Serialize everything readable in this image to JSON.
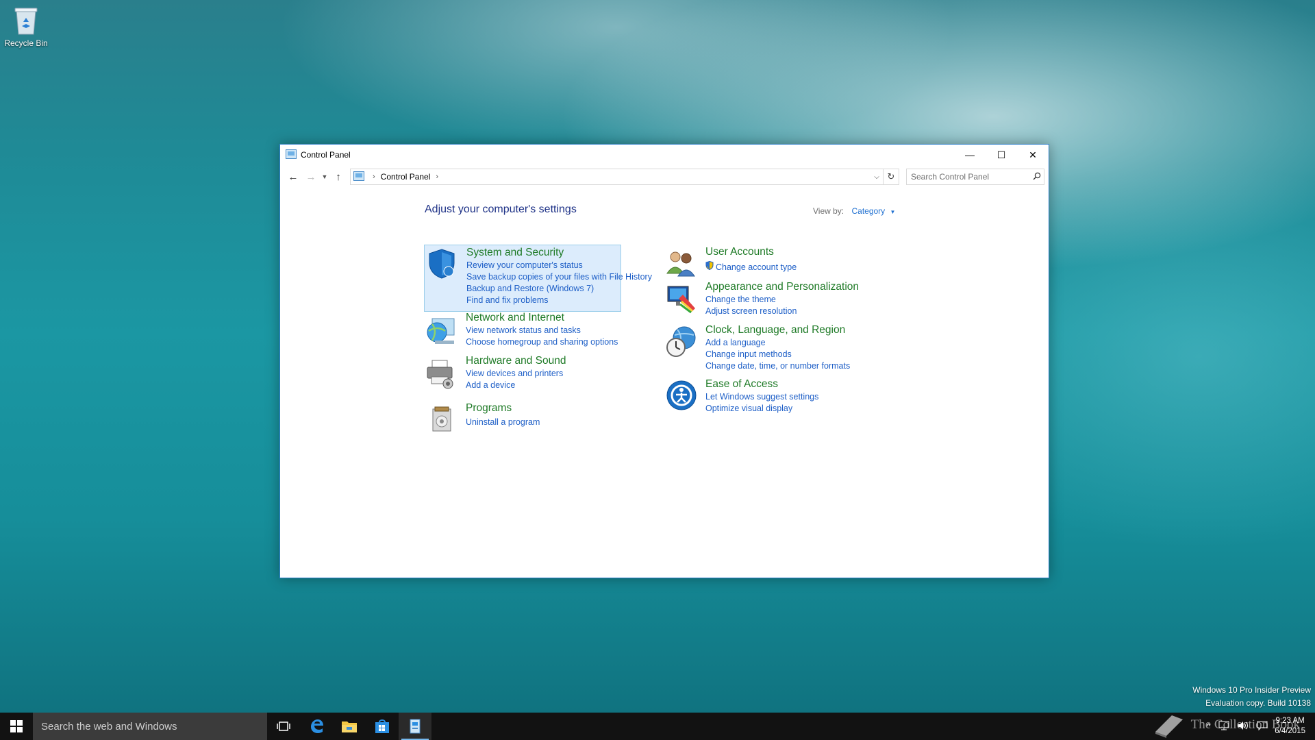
{
  "desktop": {
    "recycle_bin_label": "Recycle Bin"
  },
  "window": {
    "title": "Control Panel",
    "controls": {
      "minimize": "—",
      "maximize": "☐",
      "close": "✕"
    }
  },
  "navigation": {
    "breadcrumb": [
      "Control Panel"
    ],
    "search_placeholder": "Search Control Panel"
  },
  "content": {
    "heading": "Adjust your computer's settings",
    "view_by_label": "View by:",
    "view_by_value": "Category"
  },
  "categories_left": [
    {
      "title": "System and Security",
      "icon": "shield-icon",
      "links": [
        "Review your computer's status",
        "Save backup copies of your files with File History",
        "Backup and Restore (Windows 7)",
        "Find and fix problems"
      ]
    },
    {
      "title": "Network and Internet",
      "icon": "network-globe-icon",
      "links": [
        "View network status and tasks",
        "Choose homegroup and sharing options"
      ]
    },
    {
      "title": "Hardware and Sound",
      "icon": "printer-icon",
      "links": [
        "View devices and printers",
        "Add a device"
      ]
    },
    {
      "title": "Programs",
      "icon": "programs-icon",
      "links": [
        "Uninstall a program"
      ]
    }
  ],
  "categories_right": [
    {
      "title": "User Accounts",
      "icon": "users-icon",
      "links": [
        "Change account type"
      ]
    },
    {
      "title": "Appearance and Personalization",
      "icon": "monitor-paint-icon",
      "links": [
        "Change the theme",
        "Adjust screen resolution"
      ]
    },
    {
      "title": "Clock, Language, and Region",
      "icon": "clock-globe-icon",
      "links": [
        "Add a language",
        "Change input methods",
        "Change date, time, or number formats"
      ]
    },
    {
      "title": "Ease of Access",
      "icon": "ease-of-access-icon",
      "links": [
        "Let Windows suggest settings",
        "Optimize visual display"
      ]
    }
  ],
  "taskbar": {
    "search_placeholder": "Search the web and Windows",
    "clock_time": "9:23 AM",
    "clock_date": "6/4/2015"
  },
  "watermark": {
    "line1": "Windows 10 Pro Insider Preview",
    "line2": "Evaluation copy. Build 10138",
    "overlay_text": "The Collection Book"
  },
  "colors": {
    "category_title": "#1e7a26",
    "link": "#1e5fc7",
    "heading": "#1e3287",
    "selection_bg": "#dcecfc",
    "taskbar": "#121212"
  }
}
